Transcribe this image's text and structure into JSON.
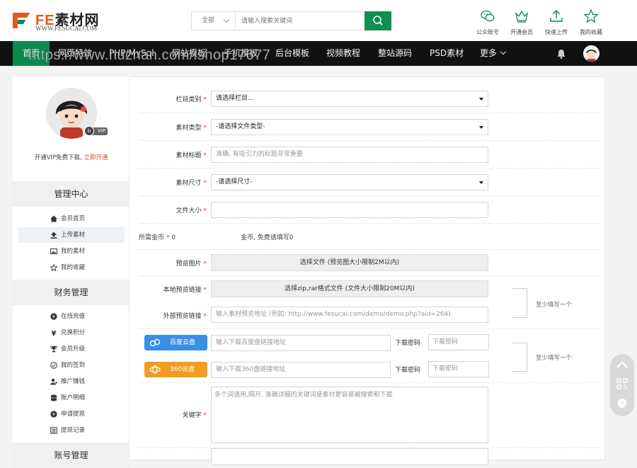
{
  "brand": {
    "name_en": "FE",
    "name_cn": "素材网",
    "site": "WWW.FESUCAI.COM",
    "color": "#e05a24"
  },
  "search": {
    "category": "全部",
    "placeholder": "请输入搜索关键词"
  },
  "tools": [
    {
      "label": "公众账号",
      "icon": "wechat-icon"
    },
    {
      "label": "开通会员",
      "icon": "crown-icon"
    },
    {
      "label": "快速上传",
      "icon": "upload-icon"
    },
    {
      "label": "我的收藏",
      "icon": "star-icon"
    }
  ],
  "nav": {
    "items": [
      "首页",
      "网页特效",
      "PHP/MySql",
      "网站模板",
      "手机模板",
      "后台模板",
      "视频教程",
      "整站源码",
      "PSD素材"
    ],
    "more": "更多",
    "accent": "#0a8b4e"
  },
  "watermark": "https://www.huzhan.com/ishop17677",
  "sidebar": {
    "vip_badge": "VIP",
    "vip_level": "b",
    "vip_prompt": "开通VIP免费下载,",
    "vip_link": "立即开通",
    "sections": [
      {
        "title": "管理中心",
        "items": [
          "会员首页",
          "上传素材",
          "我的素材",
          "我的收藏"
        ]
      },
      {
        "title": "财务管理",
        "items": [
          "在线充值",
          "兑换积分",
          "会员升级",
          "我的签到",
          "推广赚钱",
          "账户明细",
          "申请提现",
          "提现记录"
        ]
      },
      {
        "title": "账号管理",
        "items": []
      }
    ]
  },
  "form": {
    "category": {
      "label": "栏目类别",
      "value": "请选择栏目..."
    },
    "type": {
      "label": "素材类型",
      "value": "-请选择文件类型-"
    },
    "title": {
      "label": "素材标题",
      "placeholder": "准确, 有吸引力的标题非常重要"
    },
    "size": {
      "label": "素材尺寸",
      "value": "-请选择尺寸-"
    },
    "filesize": {
      "label": "文件大小",
      "value": ""
    },
    "coins": {
      "label": "所需金币",
      "value": "0",
      "note": "金币, 免费请填写0"
    },
    "preview_img": {
      "label": "预览图片",
      "button": "选择文件 (预览图大小限制2M以内)"
    },
    "local_preview": {
      "label": "本地预览链接",
      "button": "选择zip,rar格式文件 (文件大小限制20M以内)"
    },
    "external_preview": {
      "label": "外部预览链接",
      "placeholder": "输入素材预览地址 (例如: http://www.fesucai.com/demo/demo.php?aid=264)"
    },
    "preview_note": "至少填写一个",
    "baidu": {
      "button": "百度云盘",
      "placeholder": "输入下载百度盘链接地址",
      "pwd_label": "下载密码",
      "pwd_placeholder": "下载密码",
      "color": "#3a8ee6"
    },
    "pan360": {
      "button": "360云盘",
      "placeholder": "输入下载360盘链接地址",
      "pwd_label": "下载密码",
      "pwd_placeholder": "下载密码",
      "color": "#f29d1f"
    },
    "download_note": "至少填写一个",
    "keywords": {
      "label": "关键字",
      "placeholder": "多个词请用,隔开, 准确详细的关键词使素材更容易被搜索和下载"
    }
  }
}
